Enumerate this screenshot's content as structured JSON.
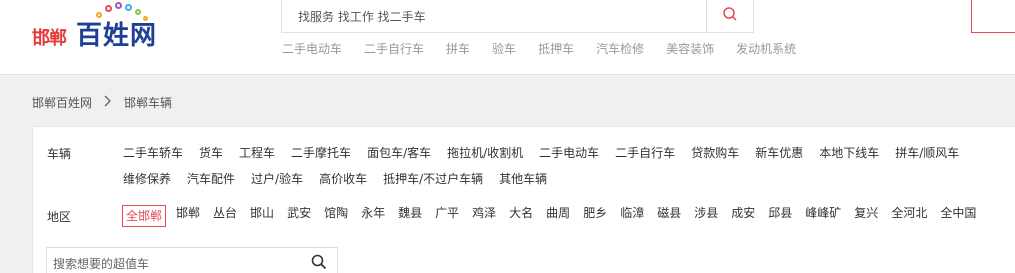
{
  "logo": {
    "city": "邯郸",
    "brand": "百姓网",
    "dot_colors": [
      "#f5a623",
      "#e64a5a",
      "#9b59b6",
      "#3bb0e0",
      "#8bc34a",
      "#f5a623"
    ]
  },
  "search": {
    "placeholder": "找服务 找工作 找二手车",
    "button_icon": "search-icon"
  },
  "hot_links": [
    "二手电动车",
    "二手自行车",
    "拼车",
    "验车",
    "抵押车",
    "汽车检修",
    "美容装饰",
    "发动机系统"
  ],
  "breadcrumb": {
    "home": "邯郸百姓网",
    "current": "邯郸车辆"
  },
  "filters": {
    "vehicle_label": "车辆",
    "vehicle_options": [
      "二手车轿车",
      "货车",
      "工程车",
      "二手摩托车",
      "面包车/客车",
      "拖拉机/收割机",
      "二手电动车",
      "二手自行车",
      "贷款购车",
      "新车优惠",
      "本地下线车",
      "拼车/顺风车",
      "维修保养",
      "汽车配件",
      "过户/验车",
      "高价收车",
      "抵押车/不过户车辆",
      "其他车辆"
    ],
    "region_label": "地区",
    "region_options": [
      "全邯郸",
      "邯郸",
      "丛台",
      "邯山",
      "武安",
      "馆陶",
      "永年",
      "魏县",
      "广平",
      "鸡泽",
      "大名",
      "曲周",
      "肥乡",
      "临漳",
      "磁县",
      "涉县",
      "成安",
      "邱县",
      "峰峰矿",
      "复兴",
      "全河北",
      "全中国"
    ],
    "region_selected": "全邯郸"
  },
  "car_search": {
    "placeholder": "搜索想要的超值车",
    "icon": "search-icon"
  },
  "colors": {
    "accent": "#e64a5a",
    "brand_blue": "#1f3f95",
    "city_red": "#e43a3a"
  }
}
